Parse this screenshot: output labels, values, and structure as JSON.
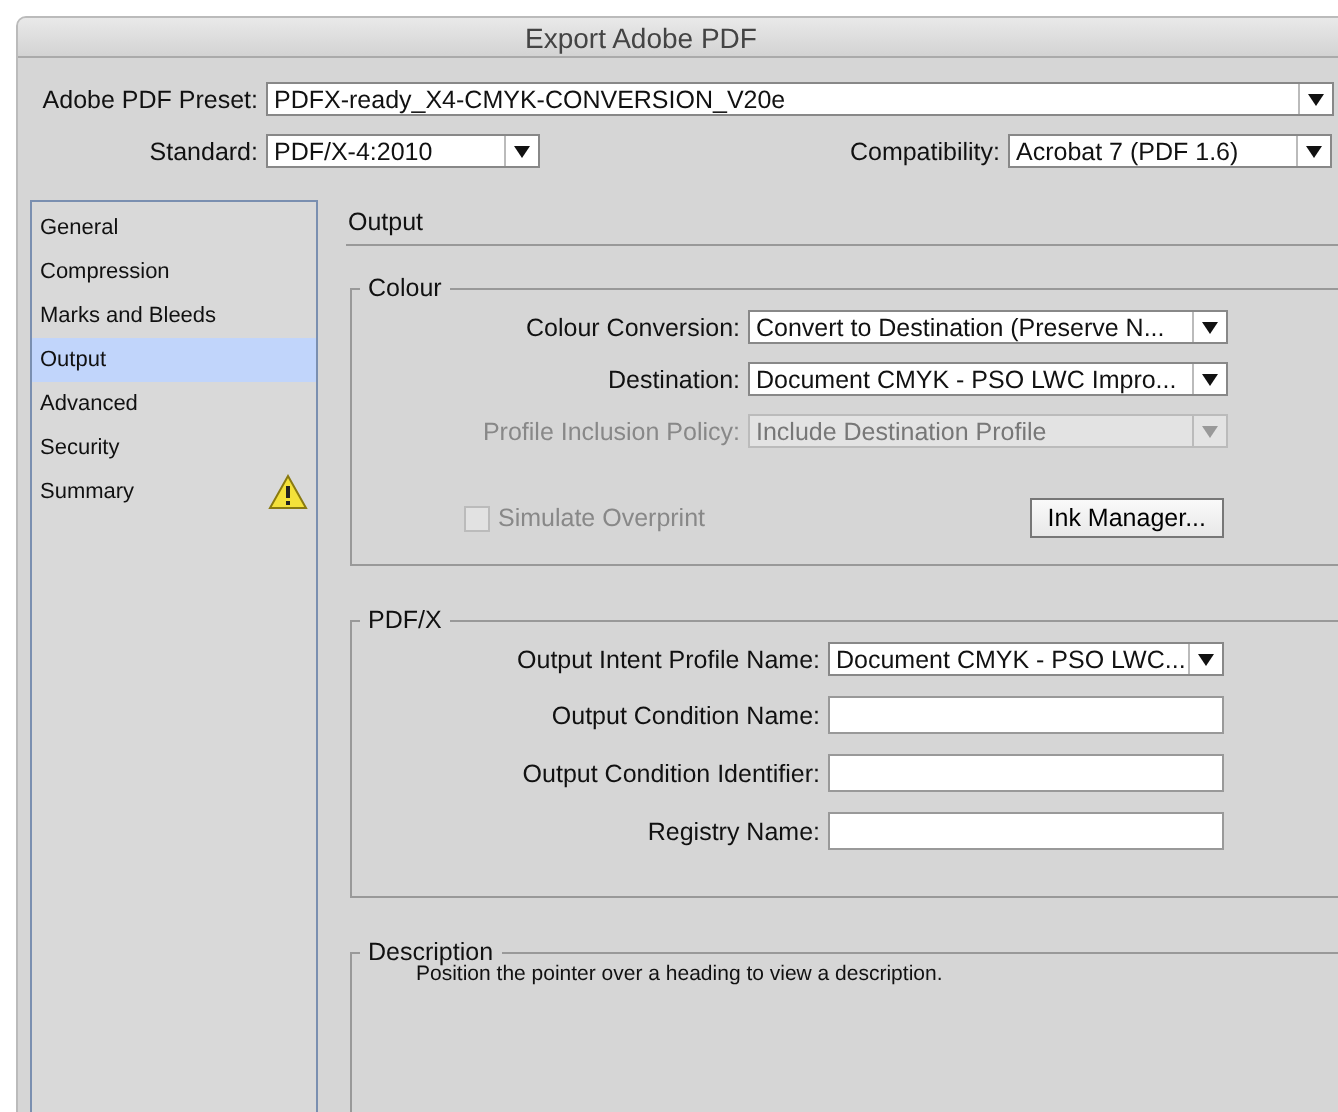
{
  "window": {
    "title": "Export Adobe PDF"
  },
  "preset": {
    "label": "Adobe PDF Preset:",
    "value": "PDFX-ready_X4-CMYK-CONVERSION_V20e"
  },
  "standard": {
    "label": "Standard:",
    "value": "PDF/X-4:2010"
  },
  "compatibility": {
    "label": "Compatibility:",
    "value": "Acrobat 7 (PDF 1.6)"
  },
  "sidebar": {
    "items": [
      {
        "label": "General",
        "selected": false,
        "warning": false
      },
      {
        "label": "Compression",
        "selected": false,
        "warning": false
      },
      {
        "label": "Marks and Bleeds",
        "selected": false,
        "warning": false
      },
      {
        "label": "Output",
        "selected": true,
        "warning": false
      },
      {
        "label": "Advanced",
        "selected": false,
        "warning": false
      },
      {
        "label": "Security",
        "selected": false,
        "warning": false
      },
      {
        "label": "Summary",
        "selected": false,
        "warning": true
      }
    ]
  },
  "section_title": "Output",
  "colour": {
    "legend": "Colour",
    "fields": [
      {
        "label": "Colour Conversion:",
        "value": "Convert to Destination (Preserve N...",
        "disabled": false
      },
      {
        "label": "Destination:",
        "value": "Document CMYK - PSO LWC Impro...",
        "disabled": false
      },
      {
        "label": "Profile Inclusion Policy:",
        "value": "Include Destination Profile",
        "disabled": true
      }
    ],
    "simulate_overprint": {
      "label": "Simulate Overprint",
      "checked": false,
      "disabled": true
    },
    "ink_manager": "Ink Manager..."
  },
  "pdfx": {
    "legend": "PDF/X",
    "fields": [
      {
        "kind": "select",
        "label": "Output Intent Profile Name:",
        "value": "Document CMYK - PSO LWC..."
      },
      {
        "kind": "text",
        "label": "Output Condition Name:"
      },
      {
        "kind": "text",
        "label": "Output Condition Identifier:"
      },
      {
        "kind": "text",
        "label": "Registry Name:"
      }
    ]
  },
  "description": {
    "legend": "Description",
    "text": "Position the pointer over a heading to view a description."
  }
}
